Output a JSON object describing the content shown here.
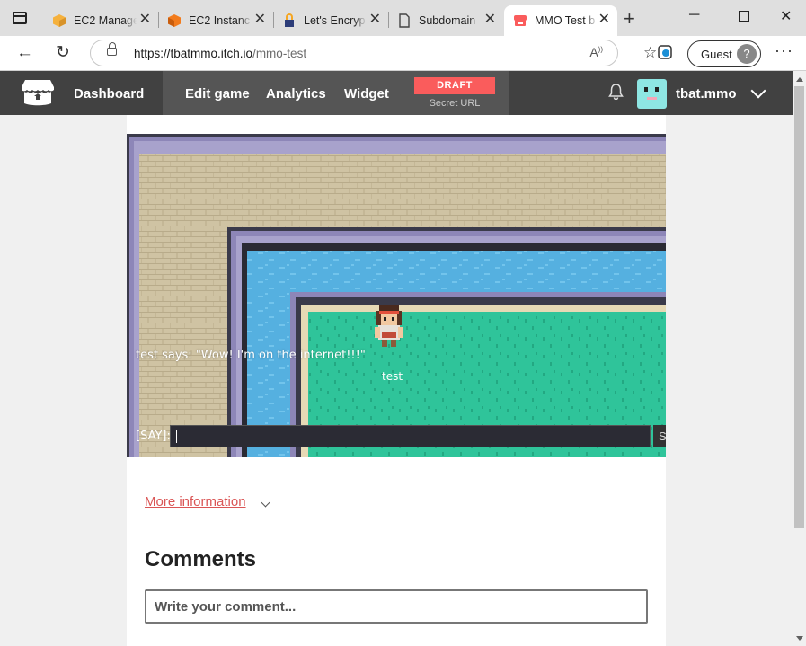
{
  "browser": {
    "tabs": [
      {
        "title": "EC2 Manage",
        "icon": "aws-cube-icon",
        "color": "#f5b13d"
      },
      {
        "title": "EC2 Instanc",
        "icon": "aws-ec2-icon",
        "color": "#f27b1c"
      },
      {
        "title": "Let's Encryp",
        "icon": "letsencrypt-icon",
        "color": "#2c3c78"
      },
      {
        "title": "Subdomain",
        "icon": "document-icon",
        "color": "#444444"
      },
      {
        "title": "MMO Test b",
        "icon": "itch-icon",
        "color": "#fa5c5c",
        "active": true
      }
    ],
    "url_host": "https://tbatmmo.itch.io",
    "url_path": "/mmo-test",
    "profile_label": "Guest"
  },
  "itch": {
    "nav": {
      "dashboard": "Dashboard",
      "edit_game": "Edit game",
      "analytics": "Analytics",
      "widget": "Widget"
    },
    "draft_badge": "DRAFT",
    "secret_url": "Secret URL",
    "username": "tbat.mmo",
    "accent_color": "#fa5c5c"
  },
  "game": {
    "chat_message": "test says: \"Wow! I'm on the internet!!!\"",
    "player_name": "test",
    "say_label": "[SAY]:",
    "say_value": "",
    "send_button": "S"
  },
  "page": {
    "more_information": "More information",
    "comments_heading": "Comments",
    "comment_placeholder": "Write your comment..."
  }
}
